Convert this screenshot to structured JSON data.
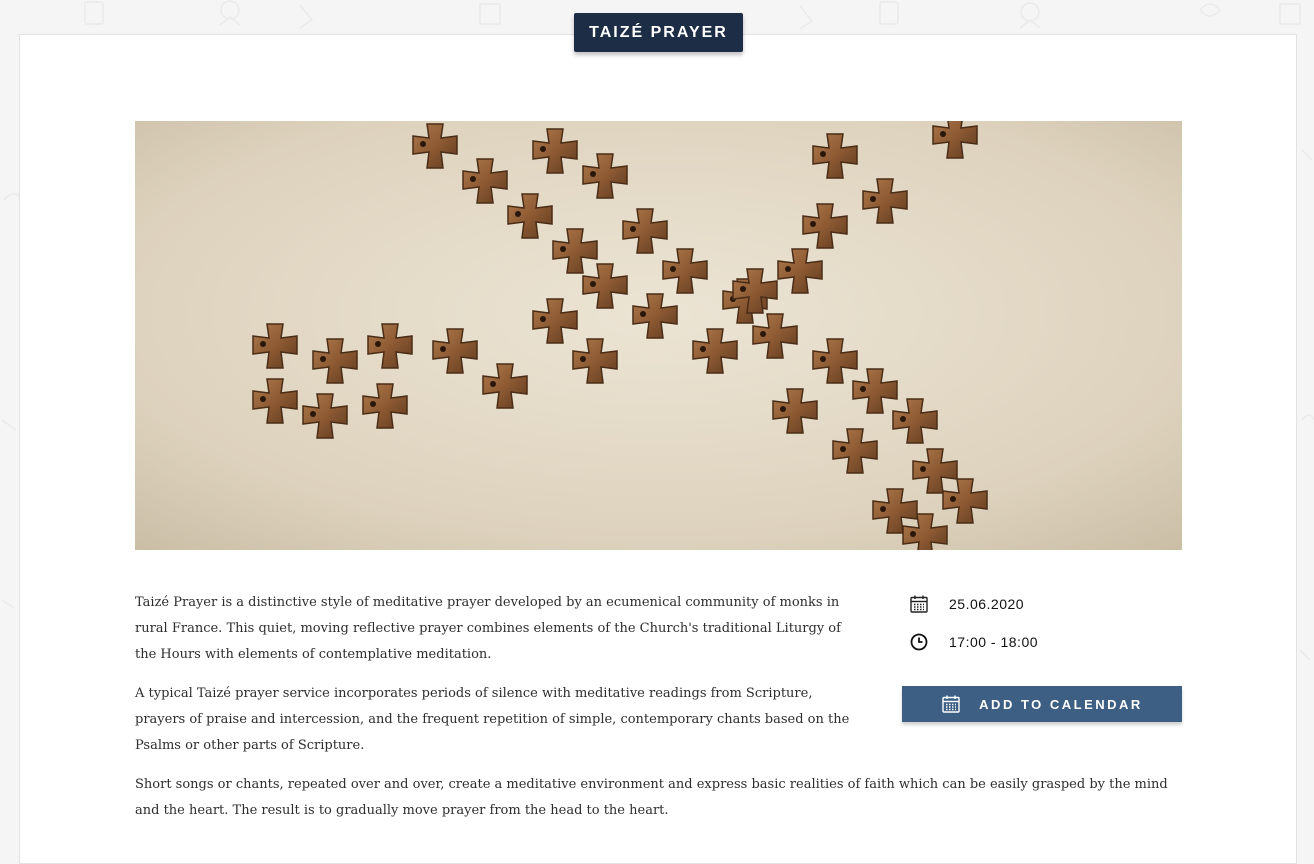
{
  "page": {
    "title": "TAIZÉ PRAYER"
  },
  "hero_image": {
    "description_icon": "wooden-dove-cross-beads-photo"
  },
  "description": {
    "paragraphs": [
      "Taizé Prayer is a distinctive style of meditative prayer developed by an ecumenical community of monks in rural France. This quiet, moving reflective prayer combines elements of the Church's traditional Liturgy of the Hours with elements of contemplative meditation.",
      "A typical Taizé prayer service incorporates periods of silence with meditative readings from Scripture, prayers of praise and intercession, and the frequent repetition of simple, contemporary chants based on the Psalms or other parts of Scripture.",
      "Short songs or chants, repeated over and over, create a meditative environment and express basic realities of faith which can be easily grasped by the mind and the heart. The result is to gradually move prayer from the head to the heart."
    ]
  },
  "event": {
    "date": "25.06.2020",
    "time": "17:00 - 18:00",
    "date_icon": "calendar-icon",
    "time_icon": "clock-icon"
  },
  "actions": {
    "add_to_calendar_label": "ADD TO CALENDAR"
  },
  "colors": {
    "badge": "#1c2d45",
    "button": "#3d5f83"
  }
}
